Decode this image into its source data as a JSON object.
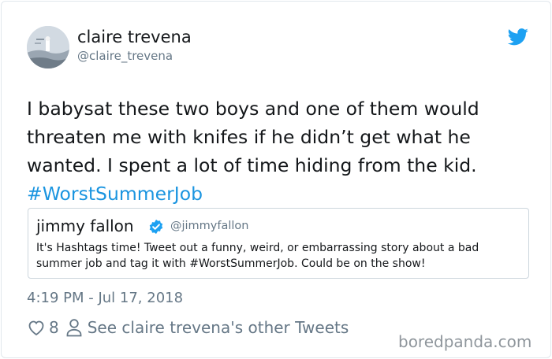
{
  "tweet": {
    "author_name": "claire trevena",
    "author_handle": "@claire_trevena",
    "text_main": "I babysat these two boys and one of them would\nthreaten me with knifes if he didn’t get what he\nwanted. I spent a lot of time hiding from the kid.\n",
    "hashtag": "#WorstSummerJob",
    "timestamp": "4:19 PM - Jul 17, 2018",
    "like_count": "8",
    "other_tweets_link": "See claire trevena's other Tweets"
  },
  "quoted_tweet": {
    "author_name": "jimmy fallon",
    "author_handle": "@jimmyfallon",
    "verified": true,
    "text": "It's Hashtags time! Tweet out a funny, weird, or embarrassing story about a bad summer job and tag it with #WorstSummerJob. Could be on the show!"
  },
  "watermark": "boredpanda.com",
  "icons": {
    "brand": "twitter-bird-icon",
    "verified": "verified-badge-icon",
    "like": "heart-icon",
    "profile": "person-icon"
  },
  "colors": {
    "twitter_blue": "#1da1f2",
    "link_blue": "#1b95e0",
    "secondary_text": "#657786",
    "border": "#e1e8ed"
  }
}
